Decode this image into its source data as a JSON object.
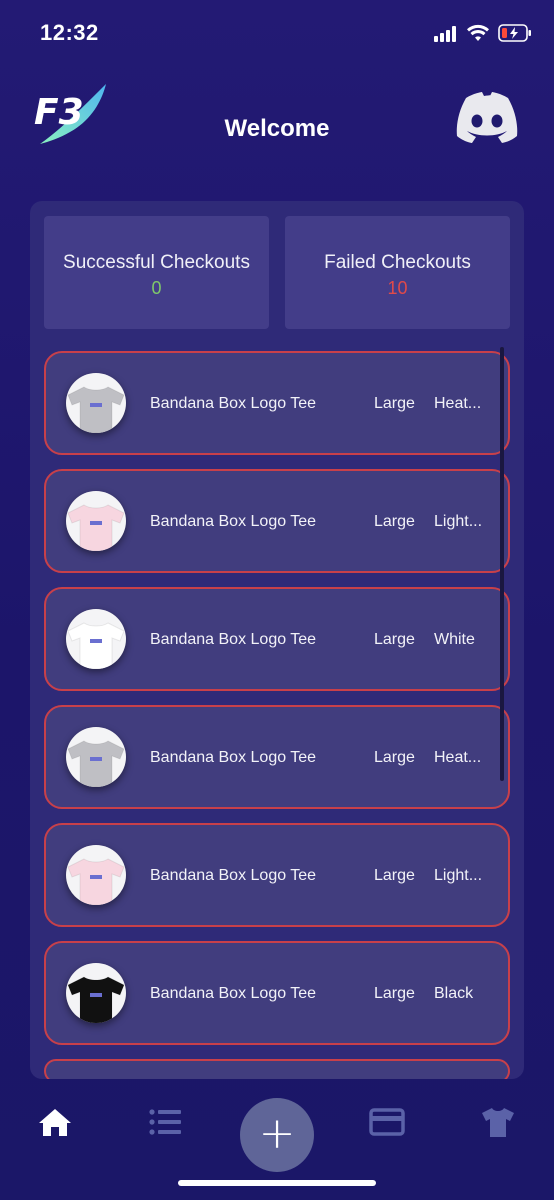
{
  "status_bar": {
    "time": "12:32"
  },
  "header": {
    "title": "Welcome",
    "logo_text": "F3"
  },
  "stats": {
    "successful": {
      "label": "Successful Checkouts",
      "value": "0"
    },
    "failed": {
      "label": "Failed Checkouts",
      "value": "10"
    }
  },
  "colors": {
    "success": "#7fc86a",
    "failure": "#e04a4a",
    "item_border": "#c8404a"
  },
  "items": [
    {
      "name": "Bandana Box Logo Tee",
      "size": "Large",
      "color": "Heat...",
      "shirt_color": "#bfbfc4"
    },
    {
      "name": "Bandana Box Logo Tee",
      "size": "Large",
      "color": "Light...",
      "shirt_color": "#f7d6e0"
    },
    {
      "name": "Bandana Box Logo Tee",
      "size": "Large",
      "color": "White",
      "shirt_color": "#ffffff"
    },
    {
      "name": "Bandana Box Logo Tee",
      "size": "Large",
      "color": "Heat...",
      "shirt_color": "#bfbfc4"
    },
    {
      "name": "Bandana Box Logo Tee",
      "size": "Large",
      "color": "Light...",
      "shirt_color": "#f7d6e0"
    },
    {
      "name": "Bandana Box Logo Tee",
      "size": "Large",
      "color": "Black",
      "shirt_color": "#111111"
    }
  ],
  "nav": {
    "add_label": "+",
    "icons": [
      "home-icon",
      "list-icon",
      "add-icon",
      "card-icon",
      "shirt-icon"
    ]
  }
}
